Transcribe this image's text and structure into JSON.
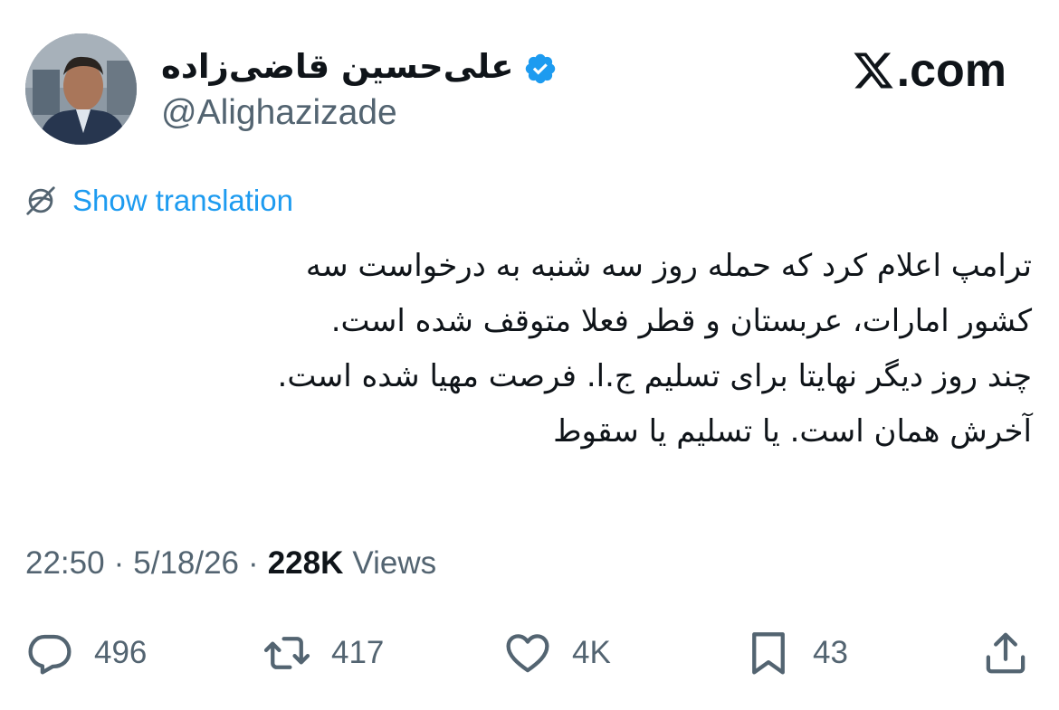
{
  "author": {
    "name": "علی‌حسین قاضی‌زاده",
    "handle": "@Alighazizade",
    "verified": true,
    "verified_color": "#1d9bf0"
  },
  "brand": {
    "logo_icon": "x-logo-icon",
    "suffix": ".com"
  },
  "translation": {
    "label": "Show translation",
    "icon": "globe-slash-icon",
    "color": "#1d9bf0"
  },
  "tweet": {
    "lines": [
      "ترامپ اعلام کرد که حمله روز سه شنبه به درخواست سه",
      "کشور امارات، عربستان و قطر فعلا متوقف شده است.",
      "چند روز دیگر نهایتا برای تسلیم ج.ا. فرصت مهیا شده است.",
      "آخرش همان است. یا تسلیم یا سقوط"
    ]
  },
  "meta": {
    "time": "22:50",
    "separator": "·",
    "date": "5/18/26",
    "views_count": "228K",
    "views_label": "Views"
  },
  "actions": {
    "reply": {
      "icon": "reply-icon",
      "count": "496"
    },
    "retweet": {
      "icon": "retweet-icon",
      "count": "417"
    },
    "like": {
      "icon": "heart-icon",
      "count": "4K"
    },
    "bookmark": {
      "icon": "bookmark-icon",
      "count": "43"
    },
    "share": {
      "icon": "share-icon"
    }
  },
  "colors": {
    "text": "#0f1419",
    "secondary": "#536471",
    "accent": "#1d9bf0"
  }
}
